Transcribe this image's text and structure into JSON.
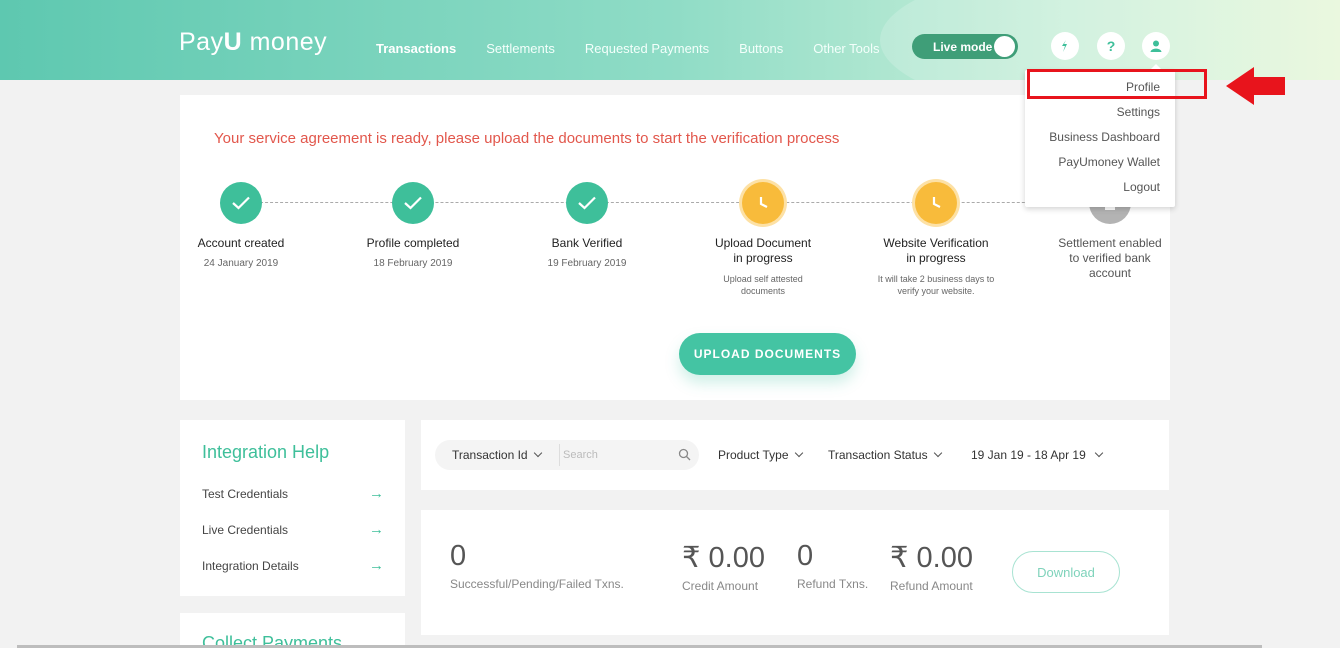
{
  "header": {
    "logo": {
      "part1": "Pay",
      "part2": "U",
      "part3": " money"
    },
    "nav": [
      {
        "label": "Transactions",
        "active": true
      },
      {
        "label": "Settlements"
      },
      {
        "label": "Requested Payments"
      },
      {
        "label": "Buttons"
      },
      {
        "label": "Other Tools"
      }
    ],
    "live_mode_label": "Live mode",
    "icons": [
      "plug-icon",
      "help-icon",
      "user-icon"
    ]
  },
  "profile_menu": {
    "items": [
      "Profile",
      "Settings",
      "Business Dashboard",
      "PayUmoney Wallet",
      "Logout"
    ],
    "highlighted": "Profile"
  },
  "verification": {
    "message": "Your service agreement is ready, please upload the documents to start the verification process",
    "steps": [
      {
        "title": "Account created",
        "sub": "24 January 2019",
        "status": "done"
      },
      {
        "title": "Profile completed",
        "sub": "18 February 2019",
        "status": "done"
      },
      {
        "title": "Bank Verified",
        "sub": "19 February 2019",
        "status": "done"
      },
      {
        "title_line1": "Upload Document",
        "title_line2": "in progress",
        "sub_line1": "Upload self attested",
        "sub_line2": "documents",
        "status": "in-progress"
      },
      {
        "title_line1": "Website Verification",
        "title_line2": "in progress",
        "sub_line1": "It will take 2 business days to",
        "sub_line2": "verify your website.",
        "status": "in-progress"
      },
      {
        "title_line1": "Settlement enabled",
        "title_line2": "to verified bank",
        "title_line3": "account",
        "status": "locked"
      }
    ],
    "upload_button": "UPLOAD DOCUMENTS"
  },
  "integration_help": {
    "title": "Integration Help",
    "items": [
      "Test Credentials",
      "Live Credentials",
      "Integration Details"
    ]
  },
  "collect_payments": {
    "title": "Collect Payments"
  },
  "filters": {
    "txn_select": "Transaction Id",
    "search_placeholder": "Search",
    "product_type": "Product Type",
    "transaction_status": "Transaction Status",
    "date_range": "19 Jan 19 - 18 Apr 19"
  },
  "stats": {
    "txn_count": {
      "value": "0",
      "label": "Successful/Pending/Failed Txns."
    },
    "credit_amount": {
      "value": "₹ 0.00",
      "label": "Credit Amount"
    },
    "refund_txns": {
      "value": "0",
      "label": "Refund Txns."
    },
    "refund_amount": {
      "value": "₹ 0.00",
      "label": "Refund Amount"
    },
    "download_button": "Download"
  },
  "colors": {
    "accent": "#3ebf9a",
    "alert": "#e2574c",
    "in_progress": "#f8bb3b",
    "highlight": "#e8141c"
  }
}
